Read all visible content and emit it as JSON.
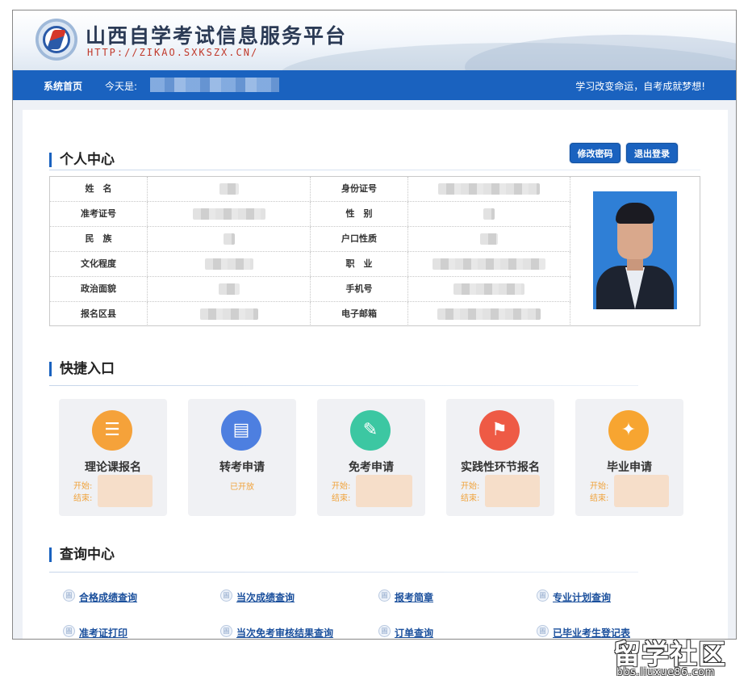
{
  "header": {
    "title": "山西自学考试信息服务平台",
    "url": "HTTP://ZIKAO.SXKSZX.CN/",
    "logo_icon": "exam-logo-icon"
  },
  "nav": {
    "home": "系统首页",
    "today_label": "今天是:",
    "slogan": "学习改变命运，自考成就梦想!"
  },
  "personal": {
    "title": "个人中心",
    "change_password": "修改密码",
    "logout": "退出登录",
    "rows": [
      {
        "label1": "姓　名",
        "label2": "身份证号"
      },
      {
        "label1": "准考证号",
        "label2": "性　别"
      },
      {
        "label1": "民　族",
        "label2": "户口性质"
      },
      {
        "label1": "文化程度",
        "label2": "职　业"
      },
      {
        "label1": "政治面貌",
        "label2": "手机号"
      },
      {
        "label1": "报名区县",
        "label2": "电子邮箱"
      }
    ]
  },
  "quick": {
    "title": "快捷入口",
    "start_label": "开始:",
    "end_label": "结束:",
    "cards": [
      {
        "label": "理论课报名",
        "icon": "stack-icon",
        "color": "#f5a23a"
      },
      {
        "label": "转考申请",
        "icon": "document-icon",
        "color": "#4d7fe0",
        "status": "已开放"
      },
      {
        "label": "免考申请",
        "icon": "edit-icon",
        "color": "#3cc7a2"
      },
      {
        "label": "实践性环节报名",
        "icon": "flag-icon",
        "color": "#ee5a45"
      },
      {
        "label": "毕业申请",
        "icon": "graduation-cap-icon",
        "color": "#f7a531"
      }
    ]
  },
  "query": {
    "title": "查询中心",
    "links": [
      "合格成绩查询",
      "当次成绩查询",
      "报考简章",
      "专业计划查询",
      "准考证打印",
      "当次免考审核结果查询",
      "订单查询",
      "已毕业考生登记表"
    ]
  },
  "watermark": {
    "big": "留学社区",
    "small": "bbs.liuxue86.com"
  },
  "colors": {
    "nav_blue": "#1a62bf",
    "link_blue": "#1a4f9c",
    "orange_text": "#f0a33c"
  }
}
